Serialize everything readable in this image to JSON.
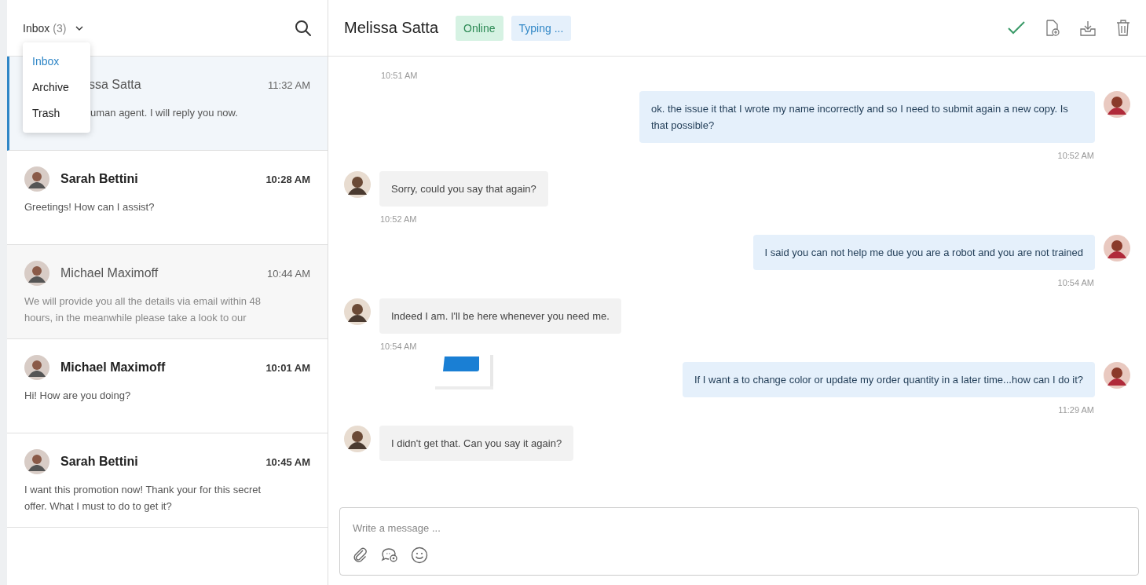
{
  "folder_menu": {
    "label": "Inbox",
    "count": "(3)",
    "options": [
      {
        "label": "Inbox",
        "selected": true
      },
      {
        "label": "Archive",
        "selected": false
      },
      {
        "label": "Trash",
        "selected": false
      }
    ]
  },
  "conversations": [
    {
      "kind": "covered",
      "name": "ssa Satta",
      "time": "11:32 AM",
      "preview": "uman agent. I will reply you now.",
      "selected": true,
      "unread": false
    },
    {
      "kind": "full",
      "name": "Sarah Bettini",
      "time": "10:28 AM",
      "preview": "Greetings! How can I assist?",
      "selected": false,
      "unread": true
    },
    {
      "kind": "full",
      "name": "Michael Maximoff",
      "time": "10:44 AM",
      "preview": "We will provide you all the details via email within 48 hours, in the meanwhile please take a look to our",
      "selected": false,
      "unread": false
    },
    {
      "kind": "full",
      "name": "Michael Maximoff",
      "time": "10:01 AM",
      "preview": "Hi! How are you doing?",
      "selected": false,
      "unread": true
    },
    {
      "kind": "full",
      "name": "Sarah Bettini",
      "time": "10:45 AM",
      "preview": "I want this promotion now! Thank your for this secret offer. What I must to do to get it?",
      "selected": false,
      "unread": true
    }
  ],
  "chat": {
    "contact": "Melissa Satta",
    "status": "Online",
    "activity": "Typing ...",
    "messages": [
      {
        "kind": "time",
        "time": "10:51 AM"
      },
      {
        "kind": "user",
        "text": "ok. the issue it that I wrote my name incorrectly and so I need to submit again a new copy. Is that possible?",
        "time": "10:52 AM"
      },
      {
        "kind": "agent",
        "text": "Sorry, could you say that again?",
        "time": "10:52 AM"
      },
      {
        "kind": "user",
        "text": "I said you can not help me due you are a robot and you are not trained",
        "time": "10:54 AM"
      },
      {
        "kind": "agent",
        "text": "Indeed I am. I'll be here whenever you need me.",
        "time": "10:54 AM"
      },
      {
        "kind": "user",
        "text": "If I want a to change color or update my order quantity in a later time...how can I do it?",
        "time": "11:29 AM"
      },
      {
        "kind": "agent",
        "text": "I didn't get that. Can you say it again?"
      }
    ],
    "composer": {
      "placeholder": "Write a message ..."
    }
  }
}
